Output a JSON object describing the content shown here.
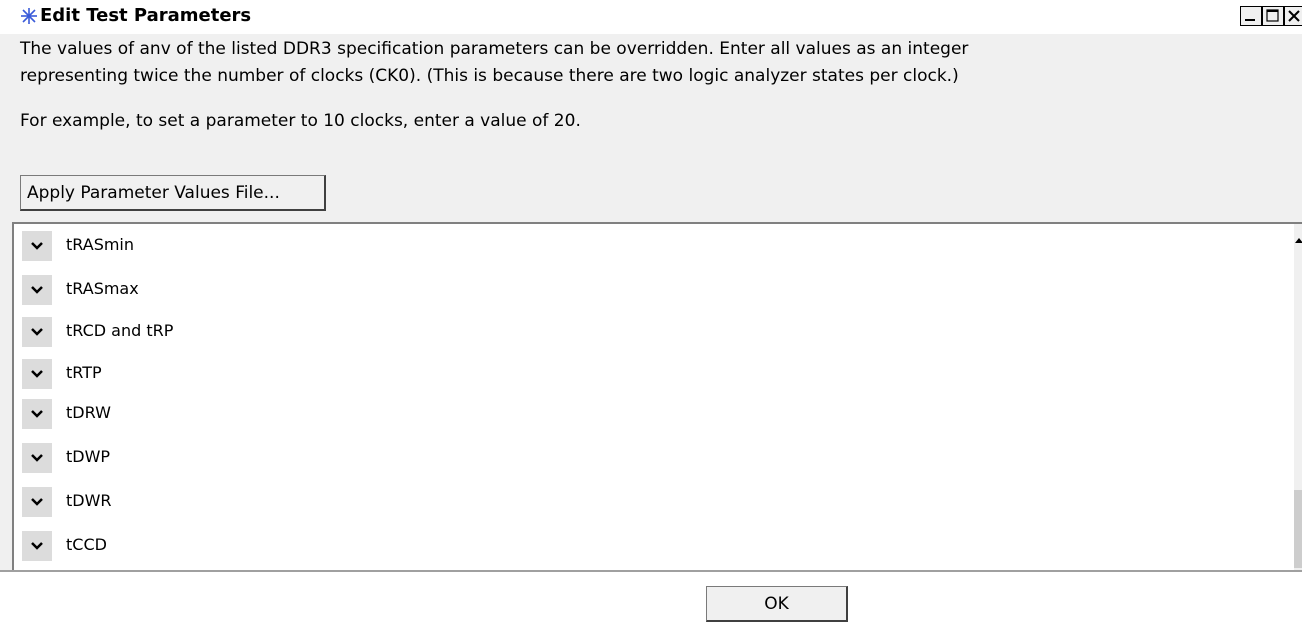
{
  "window": {
    "title": "Edit Test Parameters",
    "icon": "snowflake-app-icon",
    "controls": [
      "minimize-icon",
      "maximize-icon",
      "close-icon"
    ]
  },
  "description": {
    "line1": "The values of anv of the listed DDR3 specification parameters can be overridden. Enter all values as an integer",
    "line2": "representing twice the number of clocks (CK0). (This is because there are two logic analyzer states per clock.)",
    "example": "For example, to set a parameter to 10 clocks, enter a value of 20."
  },
  "apply_button": "Apply Parameter Values File...",
  "parameters": [
    {
      "label": "tRASmin",
      "icon": "chevron-down-icon"
    },
    {
      "label": "tRASmax",
      "icon": "chevron-down-icon"
    },
    {
      "label": "tRCD and tRP",
      "icon": "chevron-down-icon"
    },
    {
      "label": "tRTP",
      "icon": "chevron-down-icon"
    },
    {
      "label": "tDRW",
      "icon": "chevron-down-icon"
    },
    {
      "label": "tDWP",
      "icon": "chevron-down-icon"
    },
    {
      "label": "tDWR",
      "icon": "chevron-down-icon"
    },
    {
      "label": "tCCD",
      "icon": "chevron-down-icon"
    }
  ],
  "ok_button": "OK",
  "colors": {
    "title_icon": "#3a5bd9",
    "chevron_bg": "#dcdcdc"
  }
}
